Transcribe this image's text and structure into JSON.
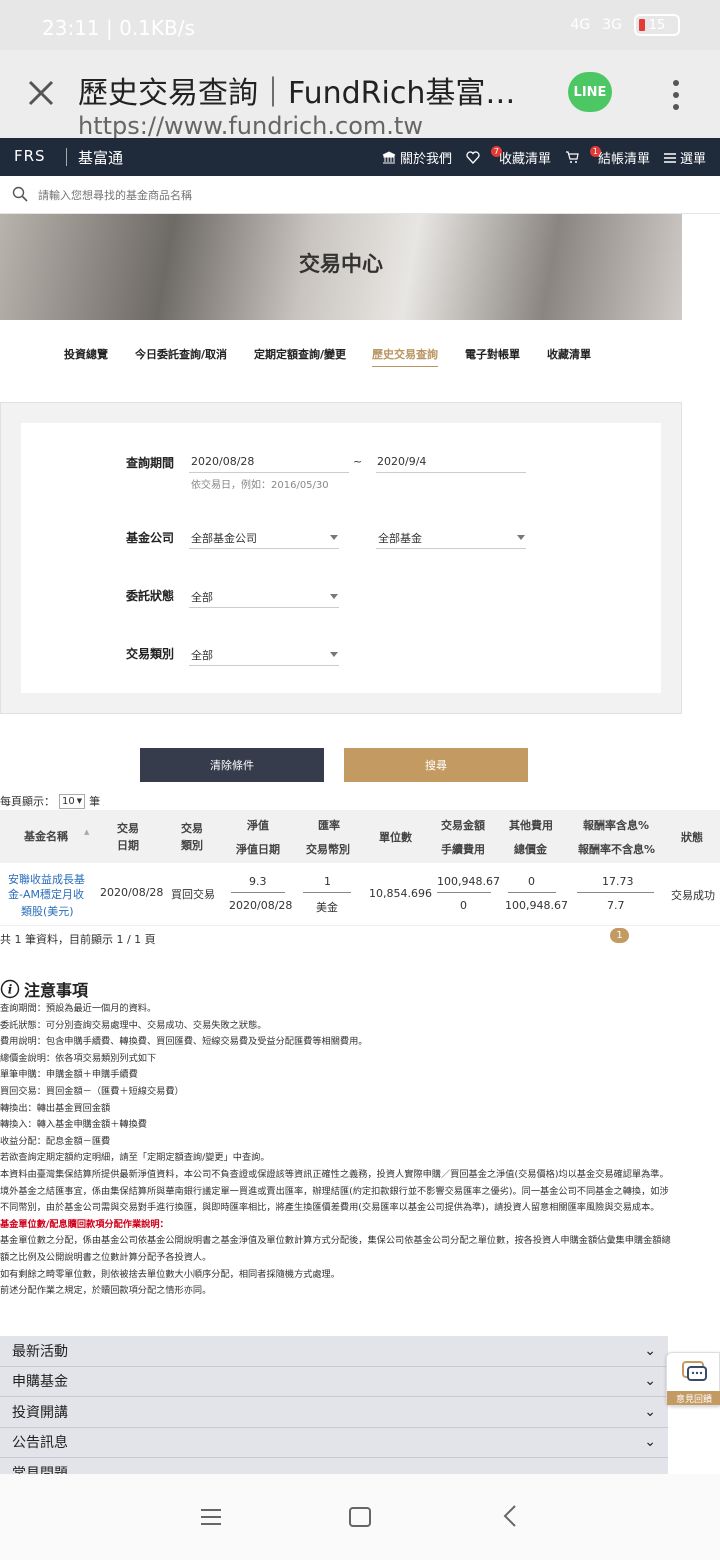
{
  "status_bar": {
    "time": "23:11",
    "speed": "0.1KB/s",
    "net1": "4G",
    "net2": "3G",
    "battery": "15"
  },
  "browser": {
    "title": "歷史交易查詢｜FundRich基富…",
    "url": "https://www.fundrich.com.tw",
    "line_label": "LINE"
  },
  "nav": {
    "logo": "FRS",
    "brand": "基富通",
    "about": "關於我們",
    "favorites": "收藏清單",
    "favorites_badge": "7",
    "checkout": "結帳清單",
    "checkout_badge": "1",
    "menu": "選單"
  },
  "search": {
    "placeholder": "請輸入您想尋找的基金商品名稱"
  },
  "banner": {
    "title": "交易中心"
  },
  "tabs": [
    "投資總覽",
    "今日委託查詢/取消",
    "定期定額查詢/變更",
    "歷史交易查詢",
    "電子對帳單",
    "收藏清單"
  ],
  "form": {
    "period_label": "查詢期間",
    "start_date": "2020/08/28",
    "tilde": "~",
    "end_date": "2020/9/4",
    "date_hint": "依交易日，例如：2016/05/30",
    "company_label": "基金公司",
    "company_value": "全部基金公司",
    "fund_value": "全部基金",
    "status_label": "委託狀態",
    "status_value": "全部",
    "type_label": "交易類別",
    "type_value": "全部"
  },
  "buttons": {
    "clear": "清除條件",
    "search": "搜尋"
  },
  "page_size": {
    "prefix": "每頁顯示：",
    "value": "10",
    "suffix": "筆"
  },
  "table": {
    "headers": {
      "fund_name": "基金名稱",
      "trade": "交易",
      "date": "日期",
      "trade2": "交易",
      "type": "類別",
      "nav": "淨值",
      "nav_date": "淨值日期",
      "fx": "匯率",
      "currency": "交易幣別",
      "units": "單位數",
      "amount": "交易金額",
      "fee": "手續費用",
      "other_fee": "其他費用",
      "total": "總價金",
      "ret_incl": "報酬率含息%",
      "ret_excl": "報酬率不含息%",
      "status": "狀態"
    },
    "row": {
      "fund_name_1": "安聯收益成長基",
      "fund_name_2": "金-AM穩定月收",
      "fund_name_3": "類股(美元)",
      "date": "2020/08/28",
      "type": "買回交易",
      "nav": "9.3",
      "nav_date": "2020/08/28",
      "fx": "1",
      "currency": "美金",
      "units": "10,854.696",
      "amount": "100,948.67",
      "fee": "0",
      "other_fee": "0",
      "total": "100,948.67",
      "ret_incl": "17.73",
      "ret_excl": "7.7",
      "status": "交易成功"
    }
  },
  "summary": "共 1 筆資料，目前顯示 1 / 1 頁",
  "current_page": "1",
  "notes": {
    "title": "注意事項",
    "lines": [
      "查詢期間：預設為最近一個月的資料。",
      "委託狀態：可分別查詢交易處理中、交易成功、交易失敗之狀態。",
      "費用說明：包含申購手續費、轉換費、買回匯費、短線交易費及受益分配匯費等相關費用。",
      "總價金說明：依各項交易類別列式如下",
      "單筆申購：申購金額＋申購手續費",
      "買回交易：買回金額－（匯費＋短線交易費）",
      "轉換出：轉出基金買回金額",
      "轉換入：轉入基金申購金額＋轉換費",
      "收益分配：配息金額－匯費",
      "若欲查詢定期定額約定明細，請至「定期定額查詢/變更」中查詢。",
      "本資料由臺灣集保結算所提供最新淨值資料，本公司不負查證或保證該等資訊正確性之義務，投資人實際申購／買回基金之淨值(交易價格)均以基金交易確認單為準。",
      "境外基金之結匯事宜，係由集保結算所與華南銀行議定單一買進或賣出匯率，辦理結匯(約定扣款銀行並不影響交易匯率之優劣)。同一基金公司不同基金之轉換，如涉不同幣別，由於基金公司需與交易對手進行換匯，與即時匯率相比，將產生換匯價差費用(交易匯率以基金公司提供為準)，請投資人留意相關匯率風險與交易成本。"
    ],
    "red_line": "基金單位數/配息贖回款項分配作業說明：",
    "after_lines": [
      "基金單位數之分配，係由基金公司依基金公開說明書之基金淨值及單位數計算方式分配後，集保公司依基金公司分配之單位數，按各投資人申購金額佔彙集申購金額總額之比例及公開說明書之位數計算分配予各投資人。",
      "如有剩餘之畸零單位數，則依被捨去單位數大小順序分配，相同者採隨機方式處理。",
      "前述分配作業之規定，於贖回款項分配之情形亦同。"
    ]
  },
  "accordion": [
    "最新活動",
    "申購基金",
    "投資開講",
    "公告訊息",
    "常見問題"
  ],
  "feedback": "意見回饋"
}
